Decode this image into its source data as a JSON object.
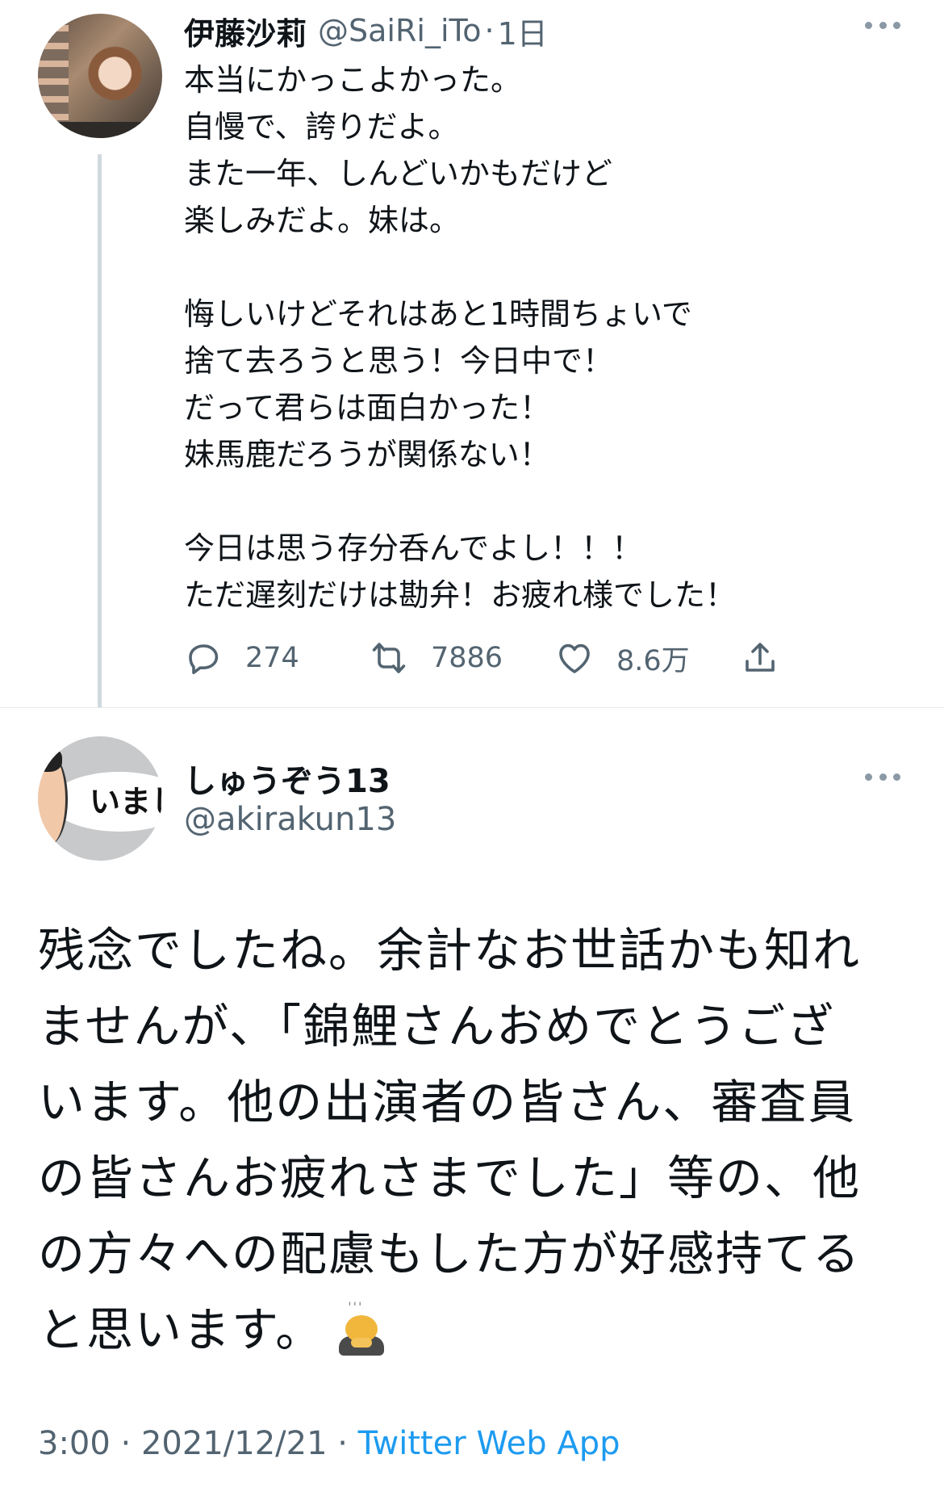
{
  "colors": {
    "text": "#0f1419",
    "secondary": "#536471",
    "link": "#1d9bf0",
    "thread_line": "#cfd9de"
  },
  "reply_tweet": {
    "author_name": "伊藤沙莉",
    "handle": "@SaiRi_iTo",
    "time_sep": "·",
    "time": "1日",
    "more_icon": "more-horizontal-icon",
    "lines": [
      "本当にかっこよかった。",
      "自慢で、誇りだよ。",
      "また一年、しんどいかもだけど",
      "楽しみだよ。妹は。",
      "",
      "悔しいけどそれはあと1時間ちょいで",
      "捨て去ろうと思う！今日中で！",
      "だって君らは面白かった！",
      "妹馬鹿だろうが関係ない！",
      "",
      "今日は思う存分呑んでよし！！！",
      "ただ遅刻だけは勘弁！お疲れ様でした！"
    ],
    "actions": {
      "reply_count": "274",
      "retweet_count": "7886",
      "like_count": "8.6万"
    }
  },
  "main_tweet": {
    "author_name": "しゅうぞう13",
    "handle": "@akirakun13",
    "avatar_text": "いまし",
    "lines": [
      "残念でしたね。余計なお世話かも知れ",
      "ませんが、「錦鯉さんおめでとうござ",
      "います。他の出演者の皆さん、審査員",
      "の皆さんお疲れさまでした」等の、他",
      "の方々への配慮もした方が好感持てる",
      "と思います。"
    ],
    "emoji": "person-bowing-emoji",
    "timestamp": "3:00 · 2021/12/21 · ",
    "source": "Twitter Web App"
  }
}
